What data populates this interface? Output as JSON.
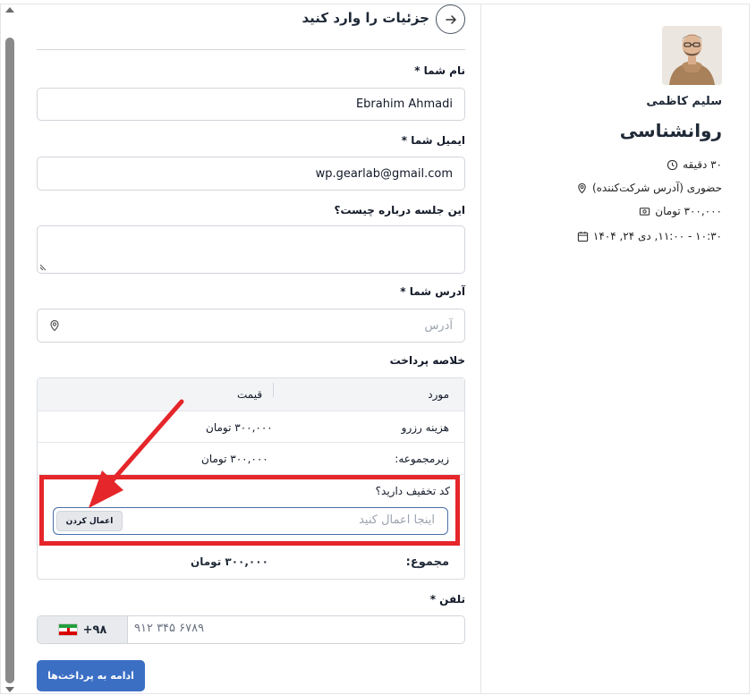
{
  "sidebar": {
    "host_name": "سلیم کاظمی",
    "service_title": "روانشناسی",
    "duration": "۳۰ دقیقه",
    "location": "حضوری (آدرس شرکت‌کننده)",
    "price": "۳۰۰,۰۰۰ تومان",
    "datetime": "۱۰:۳۰ - ۱۱:۰۰, دی ۲۴, ۱۴۰۴"
  },
  "form": {
    "title": "جزئیات را وارد کنید",
    "name_label": "نام شما *",
    "name_value": "Ebrahim Ahmadi",
    "email_label": "ایمیل شما *",
    "email_value": "wp.gearlab@gmail.com",
    "about_label": "این جلسه درباره چیست؟",
    "address_label": "آدرس شما *",
    "address_placeholder": "آدرس",
    "summary_label": "خلاصه پرداخت",
    "phone_label": "تلفن *",
    "phone_code": "+۹۸",
    "phone_placeholder": "۹۱۲ ۳۴۵ ۶۷۸۹",
    "submit_label": "ادامه به پرداخت‌ها"
  },
  "summary": {
    "col_item": "مورد",
    "col_price": "قیمت",
    "rows": [
      {
        "item": "هزینه رزرو",
        "price": "۳۰۰,۰۰۰ تومان"
      },
      {
        "item": "زیرمجموعه:",
        "price": "۳۰۰,۰۰۰ تومان"
      }
    ],
    "discount_label": "کد تخفیف دارید؟",
    "discount_placeholder": "اینجا اعمال کنید",
    "apply_label": "اعمال کردن",
    "total_label": "مجموع:",
    "total_value": "۳۰۰,۰۰۰ تومان"
  },
  "colors": {
    "accent": "#3b6fc4",
    "highlight": "#e5262a",
    "field_border": "#d1d5db"
  },
  "icons": [
    "arrow-right-icon",
    "clock-icon",
    "location-pin-icon",
    "money-icon",
    "calendar-icon",
    "iran-flag-icon"
  ]
}
